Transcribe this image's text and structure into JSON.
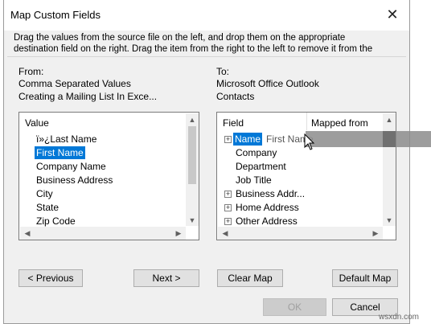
{
  "window": {
    "title": "Map Custom Fields",
    "instruction_line1": "Drag the values from the source file on the left, and drop them on the appropriate",
    "instruction_line2": "destination field on the right.  Drag the item from the right to the left to remove it from the"
  },
  "from": {
    "label": "From:",
    "source": "Comma Separated Values",
    "file": "Creating a Mailing List In Exce...",
    "column_header": "Value",
    "items": [
      "ï»¿Last Name",
      "First Name",
      "Company Name",
      "Business Address",
      "City",
      "State",
      "Zip Code"
    ],
    "selected_item": "First Name"
  },
  "to": {
    "label": "To:",
    "target": "Microsoft Office Outlook",
    "folder": "Contacts",
    "column_field": "Field",
    "column_mapped": "Mapped from",
    "rows": [
      {
        "field": "Name",
        "mapped": "First Name",
        "expandable": true,
        "selected": true
      },
      {
        "field": "Company",
        "mapped": "",
        "expandable": false
      },
      {
        "field": "Department",
        "mapped": "",
        "expandable": false
      },
      {
        "field": "Job Title",
        "mapped": "",
        "expandable": false
      },
      {
        "field": "Business Addr...",
        "mapped": "",
        "expandable": true
      },
      {
        "field": "Home Address",
        "mapped": "",
        "expandable": true
      },
      {
        "field": "Other Address",
        "mapped": "",
        "expandable": true
      }
    ],
    "drag_text": "First Name"
  },
  "buttons": {
    "previous": "< Previous",
    "next": "Next >",
    "clear_map": "Clear Map",
    "default_map": "Default Map",
    "ok": "OK",
    "cancel": "Cancel"
  },
  "watermark": "wsxdn.com",
  "icons": {
    "close": "close-icon",
    "expand": "plus-box-icon",
    "cursor": "arrow-cursor-icon"
  }
}
